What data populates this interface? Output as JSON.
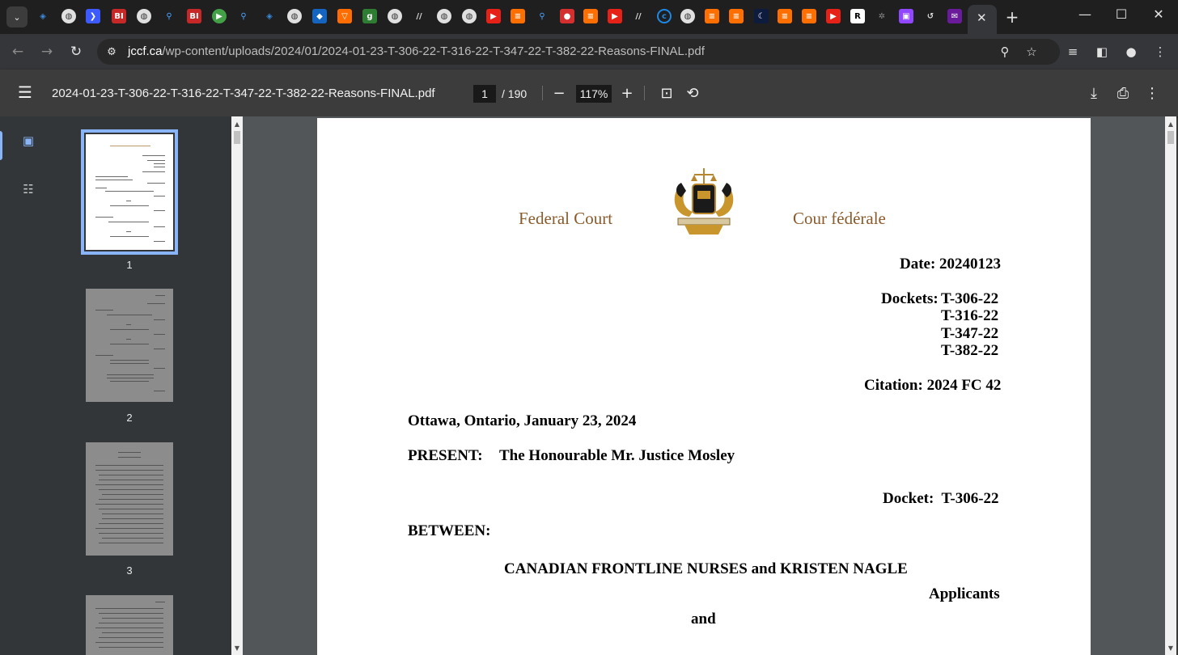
{
  "browser": {
    "active_tab_close": "✕",
    "new_tab": "+",
    "window_controls": {
      "minimize": "—",
      "maximize": "☐",
      "close": "✕"
    },
    "url_host": "jccf.ca",
    "url_path": "/wp-content/uploads/2024/01/2024-01-23-T-306-22-T-316-22-T-347-22-T-382-22-Reasons-FINAL.pdf"
  },
  "pdf_toolbar": {
    "title": "2024-01-23-T-306-22-T-316-22-T-347-22-T-382-22-Reasons-FINAL.pdf",
    "current_page": "1",
    "total_pages": "/ 190",
    "zoom": "117%"
  },
  "thumbnails": [
    {
      "label": "1"
    },
    {
      "label": "2"
    },
    {
      "label": "3"
    }
  ],
  "document": {
    "court_en": "Federal Court",
    "court_fr": "Cour fédérale",
    "date": "Date: 20240123",
    "dockets_label": "Dockets:",
    "dockets": [
      "T-306-22",
      "T-316-22",
      "T-347-22",
      "T-382-22"
    ],
    "citation": "Citation: 2024 FC 42",
    "place_date": "Ottawa, Ontario, January 23, 2024",
    "present_label": "PRESENT:",
    "present_value": "The Honourable Mr. Justice Mosley",
    "docket_line": "Docket:  T-306-22",
    "between": "BETWEEN:",
    "parties": "CANADIAN FRONTLINE NURSES and KRISTEN NAGLE",
    "applicants": "Applicants",
    "and": "and"
  },
  "colors": {
    "court_text": "#8a5a2b",
    "accent": "#8ab4f8"
  }
}
